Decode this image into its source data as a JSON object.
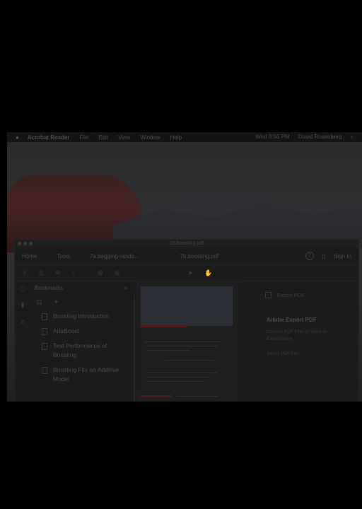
{
  "menubar": {
    "apple_icon": "apple-logo",
    "app": "Acrobat Reader",
    "items": [
      "File",
      "Edit",
      "View",
      "Window",
      "Help"
    ],
    "clock": "Wed 9:56 PM",
    "user": "David Rosenberg",
    "search_icon": "search-icon"
  },
  "window": {
    "title": "15.boosting.pdf",
    "tabs": {
      "home": "Home",
      "tools": "Tools",
      "doc1": "7a.bagging-rando...",
      "doc2": "7b.boosting.pdf"
    },
    "signin": "Sign In"
  },
  "bookmarks": {
    "header": "Bookmarks",
    "items": [
      "Boosting Introduction",
      "AdaBoost",
      "Test Performance of Boosting",
      "Boosting Fits an Additive Model"
    ]
  },
  "right_panel": {
    "export_label": "Export PDF",
    "title": "Adobe Export PDF",
    "description": "Convert PDF Files to Word or Excel Online",
    "link": "Select PDF File"
  },
  "colors": {
    "background": "#000000",
    "dimmed_accent": "#4a1c1c"
  }
}
